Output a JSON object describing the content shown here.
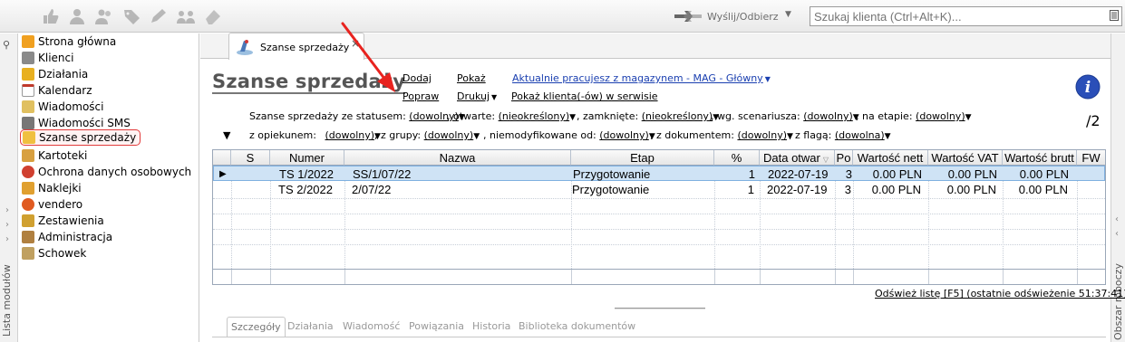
{
  "toolbar": {
    "send_label": "Wyślij/Odbierz",
    "search_placeholder": "Szukaj klienta (Ctrl+Alt+K)..."
  },
  "left_rail": {
    "label": "Lista modułów"
  },
  "right_rail": {
    "label": "Obszar roboczy"
  },
  "modules": [
    {
      "label": "Strona główna",
      "icon": "home-icon",
      "color": "#f0a020"
    },
    {
      "label": "Klienci",
      "icon": "clients-icon",
      "color": "#8a8a8a"
    },
    {
      "label": "Działania",
      "icon": "actions-icon",
      "color": "#e8b020"
    },
    {
      "label": "Kalendarz",
      "icon": "calendar-icon",
      "color": "#c0392b"
    },
    {
      "label": "Wiadomości",
      "icon": "messages-icon",
      "color": "#e0c060"
    },
    {
      "label": "Wiadomości SMS",
      "icon": "sms-icon",
      "color": "#777"
    },
    {
      "label": "Szanse sprzedaży",
      "icon": "sales-opportunities-icon",
      "color": "#f0c040",
      "active": true
    },
    {
      "label": "Kartoteki",
      "icon": "records-icon",
      "color": "#d8a040"
    },
    {
      "label": "Ochrona danych osobowych",
      "icon": "data-protection-icon",
      "color": "#d04030"
    },
    {
      "label": "Naklejki",
      "icon": "stickers-icon",
      "color": "#e0a030"
    },
    {
      "label": "vendero",
      "icon": "vendero-icon",
      "color": "#e05a20"
    },
    {
      "label": "Zestawienia",
      "icon": "reports-icon",
      "color": "#d0a030"
    },
    {
      "label": "Administracja",
      "icon": "administration-icon",
      "color": "#b08040"
    },
    {
      "label": "Schowek",
      "icon": "clipboard-icon",
      "color": "#c0a060"
    }
  ],
  "tab": {
    "label": "Szanse sprzedaży",
    "close": "×"
  },
  "page": {
    "title": "Szanse sprzedaży",
    "cmd_add": "Dodaj",
    "cmd_edit": "Popraw",
    "cmd_show": "Pokaż",
    "cmd_print": "Drukuj",
    "cmd_warehouse": "Aktualnie pracujesz z magazynem - MAG - Główny",
    "cmd_service": "Pokaż klienta(-ów) w serwisie",
    "count": "/2"
  },
  "filters": {
    "l1_a": "Szanse sprzedaży ze statusem:",
    "l1_a_val": "(dowolny)",
    "l1_b": ", otwarte:",
    "l1_b_val": "(nieokreślony)",
    "l1_c": ", zamknięte:",
    "l1_c_val": "(nieokreślony)",
    "l1_d": ", wg. scenariusza:",
    "l1_d_val": "(dowolny)",
    "l1_e": ", na etapie:",
    "l1_e_val": "(dowolny)",
    "l2_a": "z opiekunem:",
    "l2_a_val": "(dowolny)",
    "l2_b": ", z grupy:",
    "l2_b_val": "(dowolny)",
    "l2_c": ", niemodyfikowane od:",
    "l2_c_val": "(dowolny)",
    "l2_d": ", z dokumentem:",
    "l2_d_val": "(dowolny)",
    "l2_e": ", z flagą:",
    "l2_e_val": "(dowolna)"
  },
  "grid": {
    "columns": [
      "S",
      "Numer",
      "Nazwa",
      "Etap",
      "%",
      "Data otwar",
      "Po",
      "Wartość nett",
      "Wartość VAT",
      "Wartość brutt",
      "FW"
    ],
    "rows": [
      {
        "numer": "TS 1/2022",
        "nazwa": "SS/1/07/22",
        "etap": "Przygotowanie",
        "pct": "1",
        "data": "2022-07-19",
        "po": "3",
        "netto": "0.00 PLN",
        "vat": "0.00 PLN",
        "brutto": "0.00 PLN"
      },
      {
        "numer": "TS 2/2022",
        "nazwa": "2/07/22",
        "etap": "Przygotowanie",
        "pct": "1",
        "data": "2022-07-19",
        "po": "3",
        "netto": "0.00 PLN",
        "vat": "0.00 PLN",
        "brutto": "0.00 PLN"
      }
    ]
  },
  "refresh": "Odśwież listę [F5] (ostatnie odświeżenie 51:37:41)",
  "subtabs": [
    "Szczegóły",
    "Działania",
    "Wiadomość",
    "Powiązania",
    "Historia",
    "Biblioteka dokumentów"
  ]
}
